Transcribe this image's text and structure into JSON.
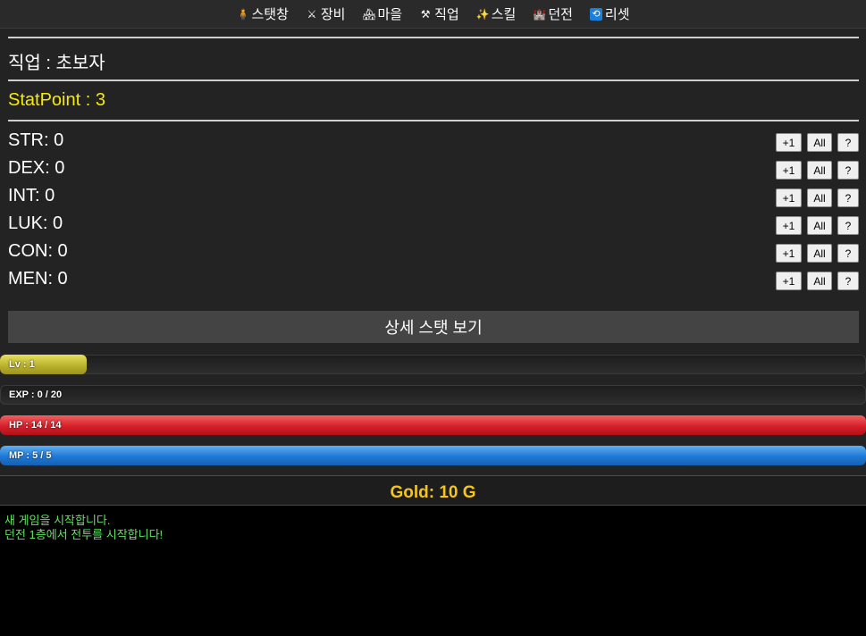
{
  "nav": [
    {
      "label": "스탯창",
      "icon": "person-icon",
      "glyph": "🧍"
    },
    {
      "label": "장비",
      "icon": "crossed-swords-icon",
      "glyph": "⚔"
    },
    {
      "label": "마을",
      "icon": "houses-icon",
      "glyph": "🏘"
    },
    {
      "label": "직업",
      "icon": "hammer-pick-icon",
      "glyph": "⚒"
    },
    {
      "label": "스킬",
      "icon": "sparkles-icon",
      "glyph": "✨"
    },
    {
      "label": "던전",
      "icon": "castle-icon",
      "glyph": "🏰"
    },
    {
      "label": "리셋",
      "icon": "reset-icon",
      "glyph": "🔁"
    }
  ],
  "job": {
    "label": "직업 : 초보자"
  },
  "stat_point": {
    "label": "StatPoint : 3"
  },
  "stats": [
    {
      "label": "STR: 0"
    },
    {
      "label": "DEX: 0"
    },
    {
      "label": "INT: 0"
    },
    {
      "label": "LUK: 0"
    },
    {
      "label": "CON: 0"
    },
    {
      "label": "MEN: 0"
    }
  ],
  "stat_buttons": {
    "plus_one": "+1",
    "all": "All",
    "help": "?"
  },
  "detail_button": {
    "label": "상세 스탯 보기"
  },
  "bars": {
    "lv": {
      "label": "Lv : 1",
      "fill_fraction": 0.1
    },
    "exp": {
      "label": "EXP : 0 / 20",
      "fill_fraction": 0.0
    },
    "hp": {
      "label": "HP : 14 / 14",
      "fill_fraction": 1.0
    },
    "mp": {
      "label": "MP : 5 / 5",
      "fill_fraction": 1.0
    }
  },
  "gold": {
    "label": "Gold: 10 G"
  },
  "log": [
    "새 게임을 시작합니다.",
    "던전 1층에서 전투를 시작합니다!"
  ],
  "colors": {
    "stat_point": "#f5e90e",
    "gold": "#f5c518",
    "log_text": "#5fe35f",
    "hp": "#d8202a",
    "mp": "#1f78d6",
    "lv": "#b8b02a"
  }
}
